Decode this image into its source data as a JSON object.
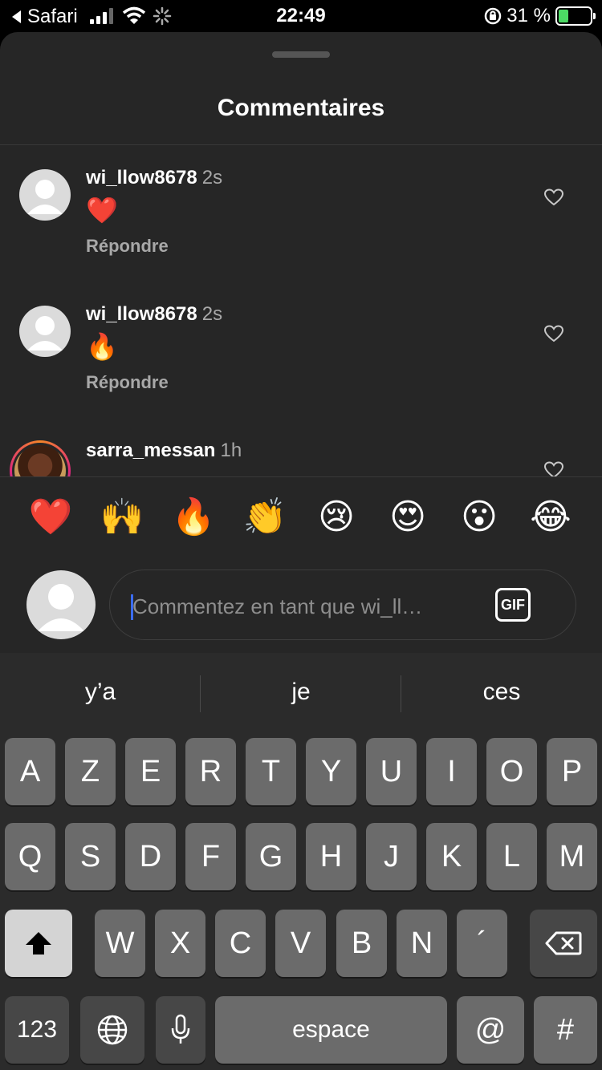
{
  "status_bar": {
    "back_label": "Safari",
    "time": "22:49",
    "battery_percent": "31 %",
    "battery_level": 0.31
  },
  "sheet": {
    "title": "Commentaires"
  },
  "comments": [
    {
      "username": "wi_llow8678",
      "time": "2s",
      "text": "❤️",
      "reply_label": "Répondre"
    },
    {
      "username": "wi_llow8678",
      "time": "2s",
      "text": "🔥",
      "reply_label": "Répondre"
    },
    {
      "username": "sarra_messan",
      "time": "1h",
      "text": "",
      "reply_label": ""
    }
  ],
  "reactions": [
    "❤️",
    "🙌",
    "🔥",
    "👏",
    "😢",
    "😍",
    "😮",
    "😂"
  ],
  "comment_input": {
    "placeholder": "Commentez en tant que wi_ll…",
    "gif_label": "GIF"
  },
  "keyboard": {
    "suggestions": [
      "y’a",
      "je",
      "ces"
    ],
    "row1": [
      "A",
      "Z",
      "E",
      "R",
      "T",
      "Y",
      "U",
      "I",
      "O",
      "P"
    ],
    "row2": [
      "Q",
      "S",
      "D",
      "F",
      "G",
      "H",
      "J",
      "K",
      "L",
      "M"
    ],
    "row3": [
      "W",
      "X",
      "C",
      "V",
      "B",
      "N",
      "´"
    ],
    "numbers_label": "123",
    "space_label": "espace",
    "at_label": "@",
    "hash_label": "#",
    "icons": [
      "shift-icon",
      "backspace-icon",
      "globe-icon",
      "microphone-icon"
    ]
  }
}
